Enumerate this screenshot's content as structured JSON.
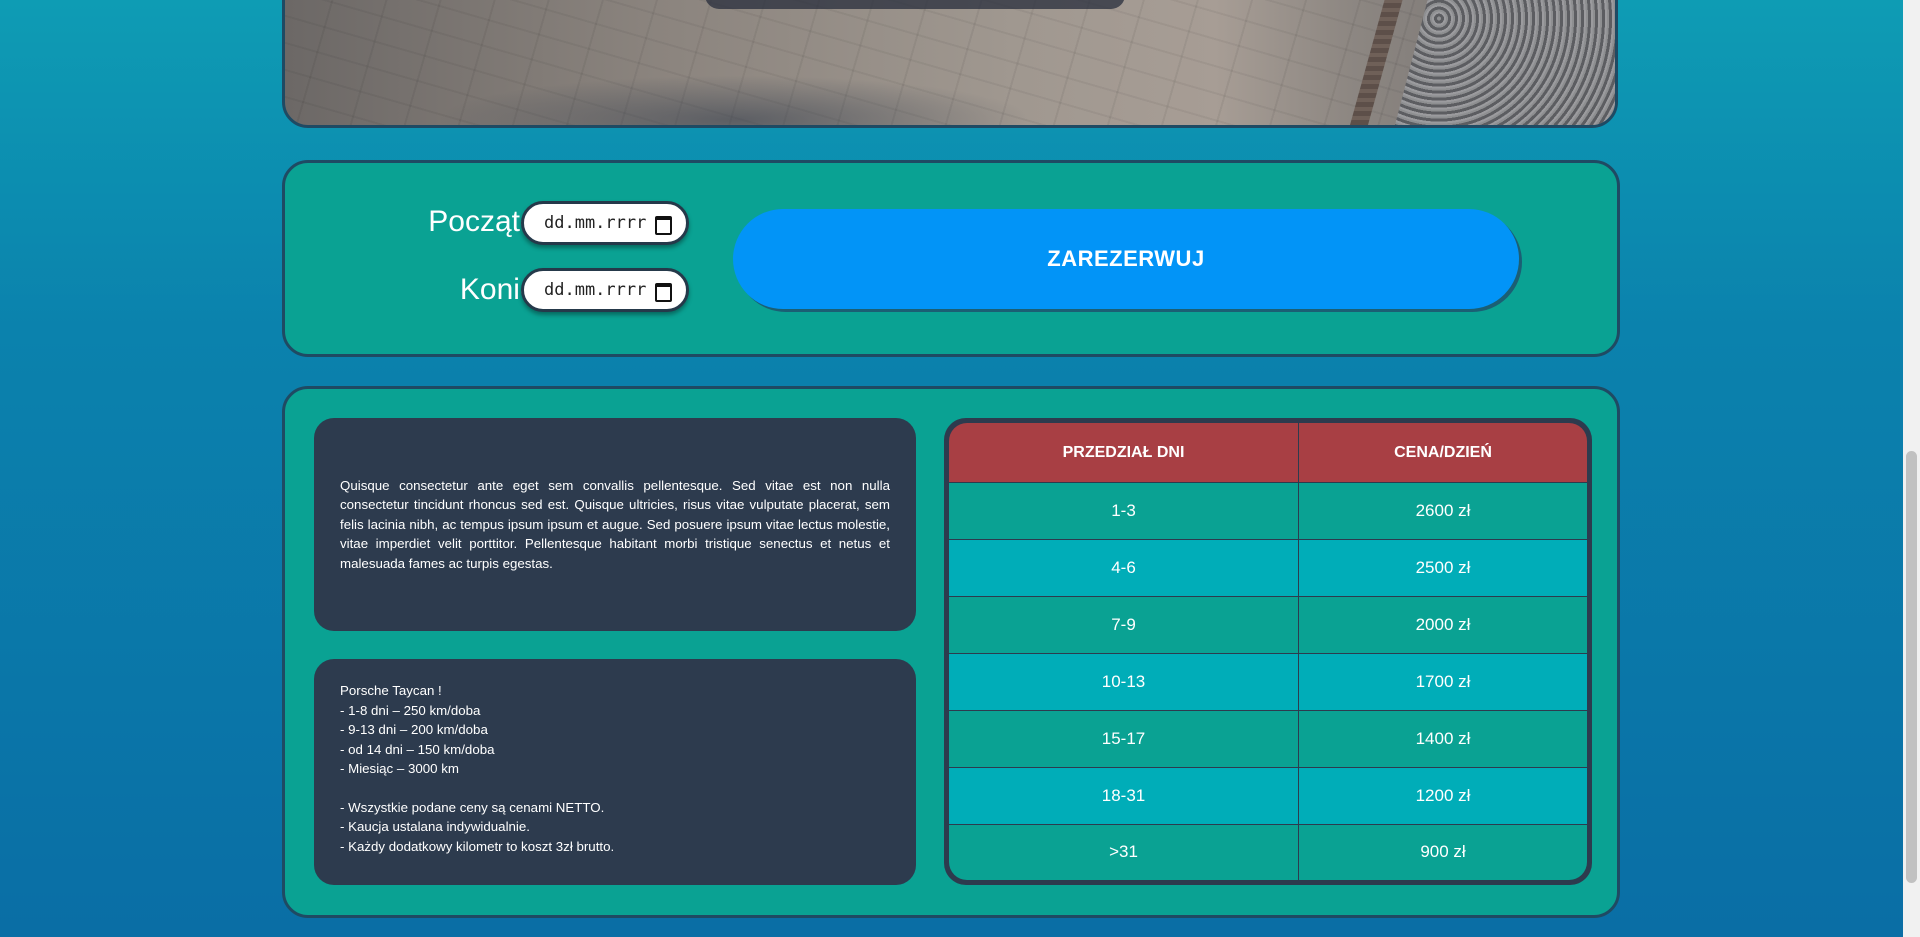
{
  "photo": {
    "description_icon": "paving-photo"
  },
  "booking": {
    "start_label": "Początek:",
    "end_label": "Koniec:",
    "start_placeholder": "dd.mm.rrrr",
    "end_placeholder": "dd.mm.rrrr",
    "reserve_label": "ZAREZERWUJ"
  },
  "description": {
    "text": "Quisque consectetur ante eget sem convallis pellentesque. Sed vitae est non nulla consectetur tincidunt rhoncus sed est. Quisque ultricies, risus vitae vulputate placerat, sem felis lacinia nibh, ac tempus ipsum ipsum et augue. Sed posuere ipsum vitae lectus molestie, vitae imperdiet velit porttitor. Pellentesque habitant morbi tristique senectus et netus et malesuada fames ac turpis egestas."
  },
  "limits": {
    "lines": [
      "Porsche Taycan !",
      "- 1-8 dni – 250 km/doba",
      "- 9-13 dni – 200 km/doba",
      "- od 14 dni – 150 km/doba",
      "- Miesiąc – 3000 km"
    ],
    "notes": [
      "- Wszystkie podane ceny są cenami NETTO.",
      "- Kaucja ustalana indywidualnie.",
      "- Każdy dodatkowy kilometr to koszt 3zł brutto."
    ]
  },
  "price_table": {
    "headers": [
      "PRZEDZIAŁ DNI",
      "CENA/DZIEŃ"
    ],
    "rows": [
      [
        "1-3",
        "2600 zł"
      ],
      [
        "4-6",
        "2500 zł"
      ],
      [
        "7-9",
        "2000 zł"
      ],
      [
        "10-13",
        "1700 zł"
      ],
      [
        "15-17",
        "1400 zł"
      ],
      [
        "18-31",
        "1200 zł"
      ],
      [
        ">31",
        "900 zł"
      ]
    ]
  },
  "colors": {
    "page_bg": "#0b82ad",
    "box_bg": "#0aa293",
    "panel_bg": "#2d3b4e",
    "header_red": "#a83f44",
    "row_alt": "#00adb8",
    "button_blue": "#0294f7"
  }
}
